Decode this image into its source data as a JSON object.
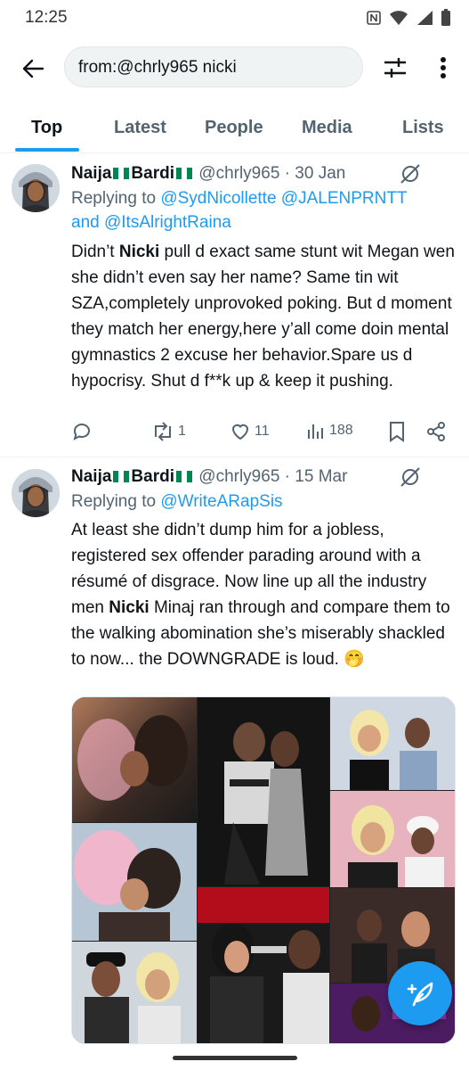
{
  "status_bar": {
    "time": "12:25"
  },
  "search": {
    "query": "from:@chrly965 nicki"
  },
  "tabs": [
    {
      "label": "Top",
      "active": true
    },
    {
      "label": "Latest"
    },
    {
      "label": "People"
    },
    {
      "label": "Media"
    },
    {
      "label": "Lists"
    }
  ],
  "tweets": [
    {
      "name_part1": "Naija",
      "name_part2": "Bardi",
      "handle": "@chrly965",
      "date": "· 30 Jan",
      "replying_prefix": "Replying to",
      "replying_line1": "@SydNicollette @JALENPRNTT",
      "replying_and": "and",
      "replying_line2": "@ItsAlrightRaina",
      "text_before": "Didn’t ",
      "highlight": "Nicki",
      "text_after": " pull d exact same stunt wit Megan wen she didn’t even say her name? Same tin wit SZA,completely unprovoked poking. But d moment they match her energy,here y’all come doin mental gymnastics 2 excuse her behavior.Spare us d hypocrisy. Shut d f**k up & keep it pushing.",
      "retweets": "1",
      "likes": "11",
      "views": "188"
    },
    {
      "name_part1": "Naija",
      "name_part2": "Bardi",
      "handle": "@chrly965",
      "date": "· 15 Mar",
      "replying_prefix": "Replying to",
      "replying_line1": "@WriteARapSis",
      "text_before": "At least she didn’t dump him for a jobless, registered sex offender parading around with a résumé of disgrace. Now line up all the industry men ",
      "highlight": "Nicki",
      "text_after": " Minaj ran through and compare them to the walking abomination she’s miserably shackled to now... the DOWNGRADE is loud. 🤭"
    }
  ],
  "colors": {
    "accent": "#1d9bf0",
    "text_primary": "#0f1419",
    "text_secondary": "#536471"
  }
}
